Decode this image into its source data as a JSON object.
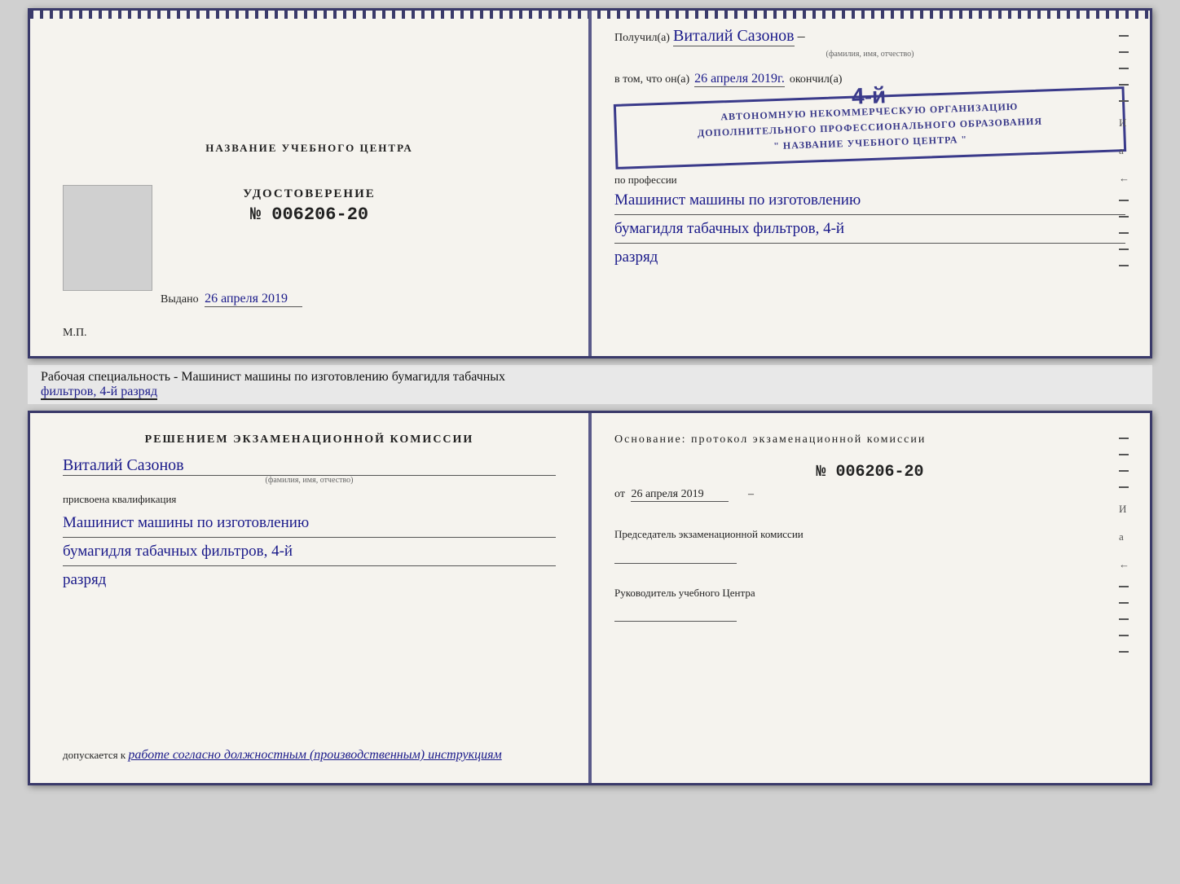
{
  "page": {
    "background": "#d0d0d0"
  },
  "cert_top": {
    "left": {
      "title": "НАЗВАНИЕ УЧЕБНОГО ЦЕНТРА",
      "udostoverenie_label": "УДОСТОВЕРЕНИЕ",
      "number": "№ 006206-20",
      "vydano_label": "Выдано",
      "vydano_date": "26 апреля 2019",
      "mp_label": "М.П."
    },
    "right": {
      "poluchil_label": "Получил(а)",
      "fio_handwritten": "Виталий Сазонов",
      "fio_sub": "(фамилия, имя, отчество)",
      "dash": "–",
      "vtom_label": "в том, что он(а)",
      "date_handwritten": "26 апреля 2019г.",
      "okonchil_label": "окончил(а)",
      "stamp_number": "4-й",
      "stamp_line1": "АВТОНОМНУЮ НЕКОММЕРЧЕСКУЮ ОРГАНИЗАЦИЮ",
      "stamp_line2": "ДОПОЛНИТЕЛЬНОГО ПРОФЕССИОНАЛЬНОГО ОБРАЗОВАНИЯ",
      "stamp_line3": "\" НАЗВАНИЕ УЧЕБНОГО ЦЕНТРА \"",
      "po_professii_label": "по профессии",
      "profession_line1": "Машинист машины по изготовлению",
      "profession_line2": "бумагидля табачных фильтров, 4-й",
      "profession_line3": "разряд"
    }
  },
  "caption": {
    "text": "Рабочая специальность - Машинист машины по изготовлению бумагидля табачных",
    "underlined_text": "фильтров, 4-й разряд"
  },
  "cert_bottom": {
    "left": {
      "resheniem_label": "Решением экзаменационной комиссии",
      "fio_handwritten": "Виталий Сазонов",
      "fio_sub": "(фамилия, имя, отчество)",
      "prisvoena_label": "присвоена квалификация",
      "qualification_line1": "Машинист машины по изготовлению",
      "qualification_line2": "бумагидля табачных фильтров, 4-й",
      "qualification_line3": "разряд",
      "dopuskaetsya_label": "допускается к",
      "dopusk_text": "работе согласно должностным (производственным) инструкциям"
    },
    "right": {
      "osnovanie_label": "Основание: протокол экзаменационной комиссии",
      "number": "№ 006206-20",
      "ot_label": "от",
      "ot_date": "26 апреля 2019",
      "predsedatel_label": "Председатель экзаменационной комиссии",
      "rukovoditel_label": "Руководитель учебного Центра",
      "letters": [
        "И",
        "а",
        "←"
      ]
    }
  }
}
